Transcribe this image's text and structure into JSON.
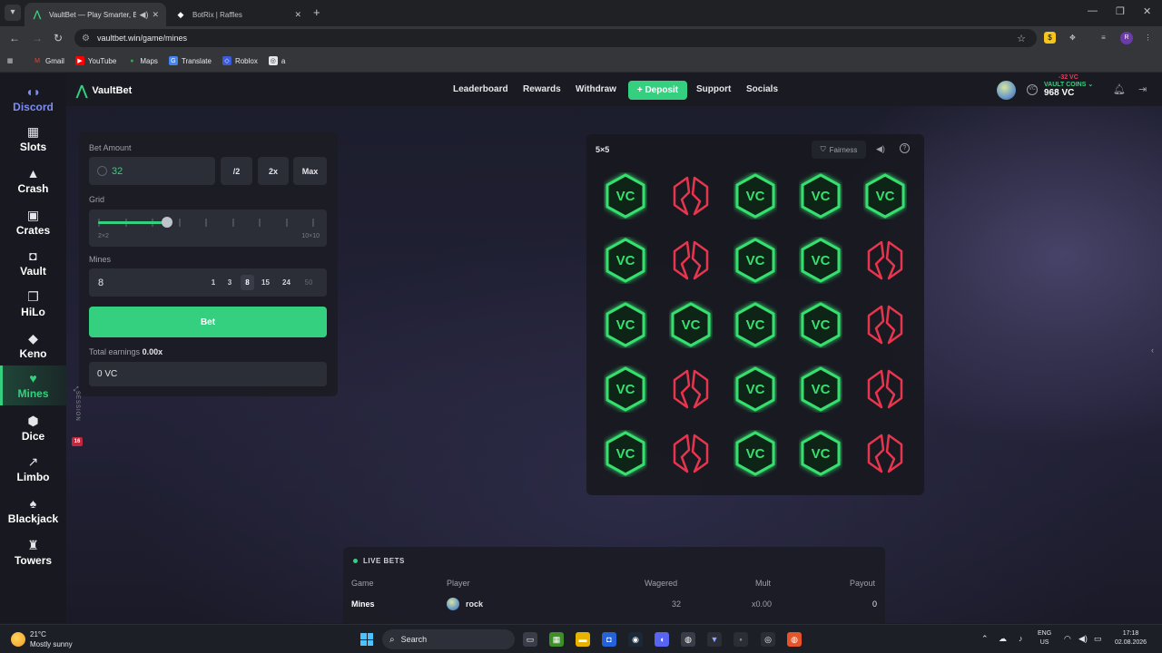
{
  "browser": {
    "tabs": [
      {
        "title": "VaultBet — Play Smarter, Be",
        "active": true
      },
      {
        "title": "BotRix | Raffles",
        "active": false
      }
    ],
    "url": "vaultbet.win/game/mines",
    "profile_initial": "R",
    "bookmarks": [
      "Gmail",
      "YouTube",
      "Maps",
      "Translate",
      "Roblox",
      "a"
    ]
  },
  "site": {
    "brand": "VaultBet",
    "topnav": [
      "Leaderboard",
      "Rewards",
      "Withdraw",
      "Support",
      "Socials"
    ],
    "deposit_label": "+ Deposit",
    "vault_coins_label": "VAULT COINS",
    "vault_coins_delta": "-32 VC",
    "vault_coins_value": "968 VC"
  },
  "sidebar": {
    "items": [
      {
        "label": "Discord",
        "icon": "discord-icon",
        "glyph": "◖◗"
      },
      {
        "label": "Slots",
        "icon": "slots-icon",
        "glyph": "▦"
      },
      {
        "label": "Crash",
        "icon": "rocket-icon",
        "glyph": "▲"
      },
      {
        "label": "Crates",
        "icon": "crate-icon",
        "glyph": "▣"
      },
      {
        "label": "Vault",
        "icon": "vault-icon",
        "glyph": "◘"
      },
      {
        "label": "HiLo",
        "icon": "cards-icon",
        "glyph": "❐"
      },
      {
        "label": "Keno",
        "icon": "keno-icon",
        "glyph": "◆"
      },
      {
        "label": "Mines",
        "icon": "gem-icon",
        "glyph": "♥"
      },
      {
        "label": "Dice",
        "icon": "dice-icon",
        "glyph": "⬢"
      },
      {
        "label": "Limbo",
        "icon": "trend-icon",
        "glyph": "↗"
      },
      {
        "label": "Blackjack",
        "icon": "blackjack-icon",
        "glyph": "♠"
      },
      {
        "label": "Towers",
        "icon": "tower-icon",
        "glyph": "♜"
      }
    ],
    "active": "Mines"
  },
  "bet_panel": {
    "bet_amount_label": "Bet Amount",
    "bet_amount_value": "32",
    "half_label": "/2",
    "double_label": "2x",
    "max_label": "Max",
    "grid_label": "Grid",
    "grid_min": "2×2",
    "grid_max": "10×10",
    "grid_level_fraction": 0.33,
    "mines_label": "Mines",
    "mines_value": "8",
    "mine_options": [
      "1",
      "3",
      "8",
      "15",
      "24",
      "50"
    ],
    "mine_selected": "8",
    "bet_button": "Bet",
    "total_earnings_label": "Total earnings",
    "total_earnings_mult": "0.00x",
    "earnings_value": "0 VC",
    "session_label": "SESSION",
    "session_count": "16"
  },
  "board": {
    "size_label": "5×5",
    "fairness_label": "Fairness",
    "tile_text": "VC",
    "tiles": [
      [
        "gem",
        "bomb",
        "gem",
        "gem",
        "gem"
      ],
      [
        "gem",
        "bomb",
        "gem",
        "gem",
        "bomb"
      ],
      [
        "gem",
        "gem",
        "gem",
        "gem",
        "bomb"
      ],
      [
        "gem",
        "bomb",
        "gem",
        "gem",
        "bomb"
      ],
      [
        "gem",
        "bomb",
        "gem",
        "gem",
        "bomb"
      ]
    ],
    "colors": {
      "gem": "#35e06f",
      "bomb": "#e8354e"
    }
  },
  "live_bets": {
    "title": "LIVE BETS",
    "columns": [
      "Game",
      "Player",
      "Wagered",
      "Mult",
      "Payout"
    ],
    "rows": [
      {
        "game": "Mines",
        "player": "rock",
        "wagered": "32",
        "mult": "x0.00",
        "payout": "0"
      }
    ]
  },
  "taskbar": {
    "temperature": "21°C",
    "weather": "Mostly sunny",
    "search_placeholder": "Search",
    "lang_top": "ENG",
    "lang_bottom": "US",
    "time": "17:18",
    "date": "02.08.2026"
  }
}
